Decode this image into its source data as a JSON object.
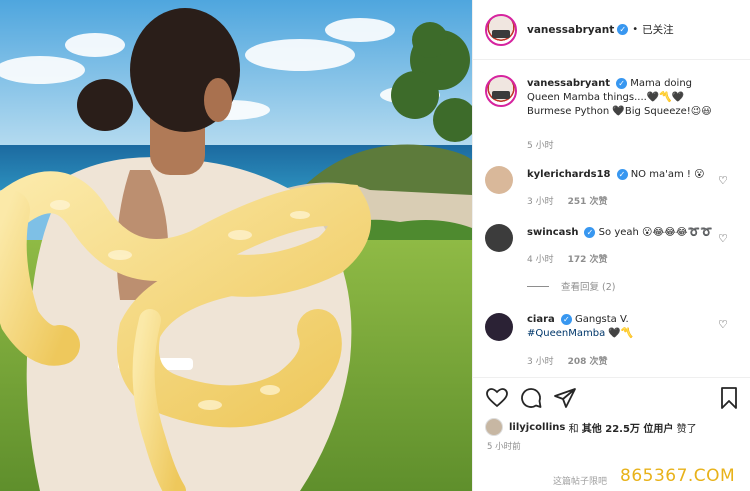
{
  "post": {
    "author": "vanessabryant",
    "header_dot": "•",
    "follow_status": "已关注"
  },
  "caption": {
    "author": "vanessabryant",
    "text": "Mama doing Queen Mamba things....🖤〽️🖤Burmese Python 🖤Big Squeeze!😉😃",
    "time": "5 小时"
  },
  "comments": [
    {
      "user": "kylerichards18",
      "verified": true,
      "text": "NO ma'am ! 😮",
      "time": "3 小时",
      "likes": "251 次赞"
    },
    {
      "user": "swincash",
      "verified": true,
      "text": "So yeah 😮😂😂😂➰➰",
      "time": "4 小时",
      "likes": "172 次赞"
    },
    {
      "user": "ciara",
      "verified": true,
      "text": "Gangsta V.",
      "hashtag": "#QueenMamba",
      "suffix": "🖤〽️",
      "time": "3 小时",
      "likes": "208 次赞"
    }
  ],
  "view_replies": "查看回复 (2)",
  "liked_by": {
    "user": "lilyjcollins",
    "connector": "和",
    "others": "其他 22.5万 位用户",
    "suffix": "赞了"
  },
  "post_time": "5 小时前",
  "footer_notice": "这篇帖子限吧",
  "watermark": "865367.COM",
  "icons": [
    "heart-icon",
    "comment-icon",
    "share-icon",
    "bookmark-icon",
    "verified-badge-icon"
  ],
  "colors": {
    "verified": "#3897f0",
    "hashtag": "#00376b",
    "meta": "#8e8e8e",
    "watermark": "#e8b21a",
    "python": "#f2d77a"
  }
}
